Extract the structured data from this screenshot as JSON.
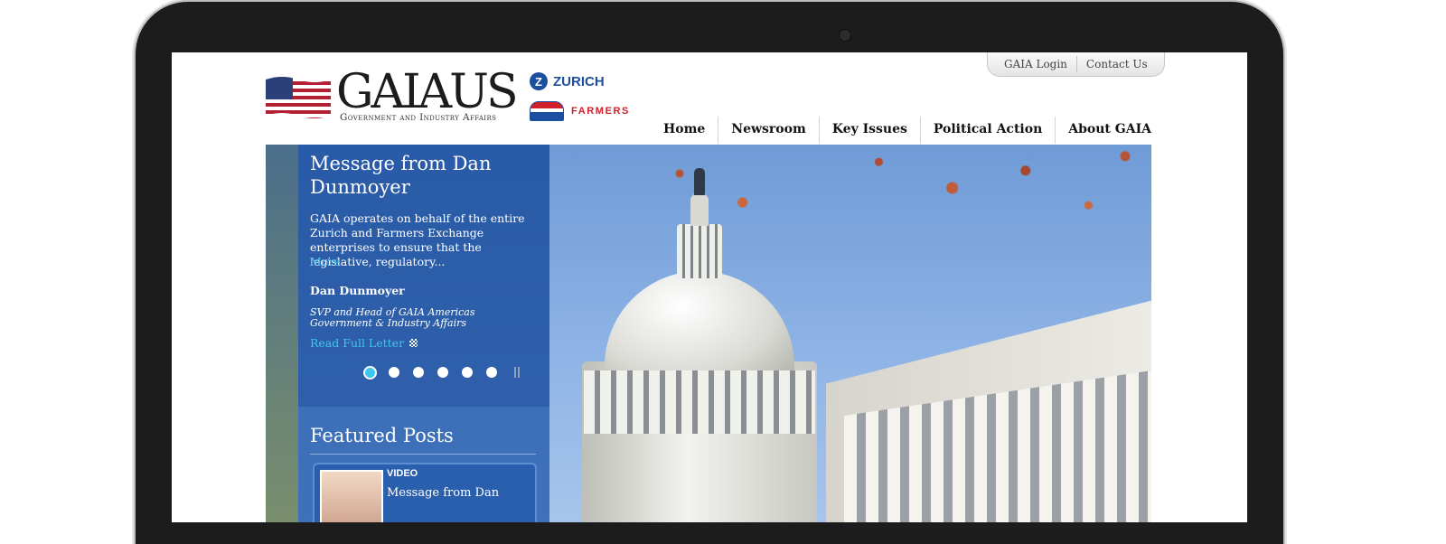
{
  "header": {
    "brand_name": "GAIAUS",
    "brand_subtitle": "Government and Industry Affairs",
    "partner_zurich": "ZURICH",
    "partner_farmers": "FARMERS"
  },
  "utility_nav": {
    "login": "GAIA Login",
    "contact": "Contact Us"
  },
  "nav": {
    "items": [
      {
        "label": "Home"
      },
      {
        "label": "Newsroom"
      },
      {
        "label": "Key Issues"
      },
      {
        "label": "Political Action"
      },
      {
        "label": "About GAIA"
      }
    ]
  },
  "slide": {
    "title": "Message from Dan Dunmoyer",
    "excerpt": "GAIA operates on behalf of the entire Zurich and Farmers Exchange enterprises to ensure that the legislative, regulatory...",
    "more_label": "More",
    "author": "Dan Dunmoyer",
    "role": "SVP and Head of GAIA Americas Government & Industry Affairs",
    "read_label": "Read Full Letter",
    "dot_count": 6,
    "active_dot": 1
  },
  "featured": {
    "heading": "Featured Posts",
    "post": {
      "tag": "VIDEO",
      "title": "Message from Dan"
    }
  },
  "icons": [
    "flag-icon",
    "zurich-logo-icon",
    "farmers-crest-icon",
    "external-link-icon",
    "pause-icon"
  ],
  "colors": {
    "panel_blue": "#1e50a0",
    "link_cyan": "#3ec6f2",
    "device_bezel": "#1c1c1c"
  }
}
